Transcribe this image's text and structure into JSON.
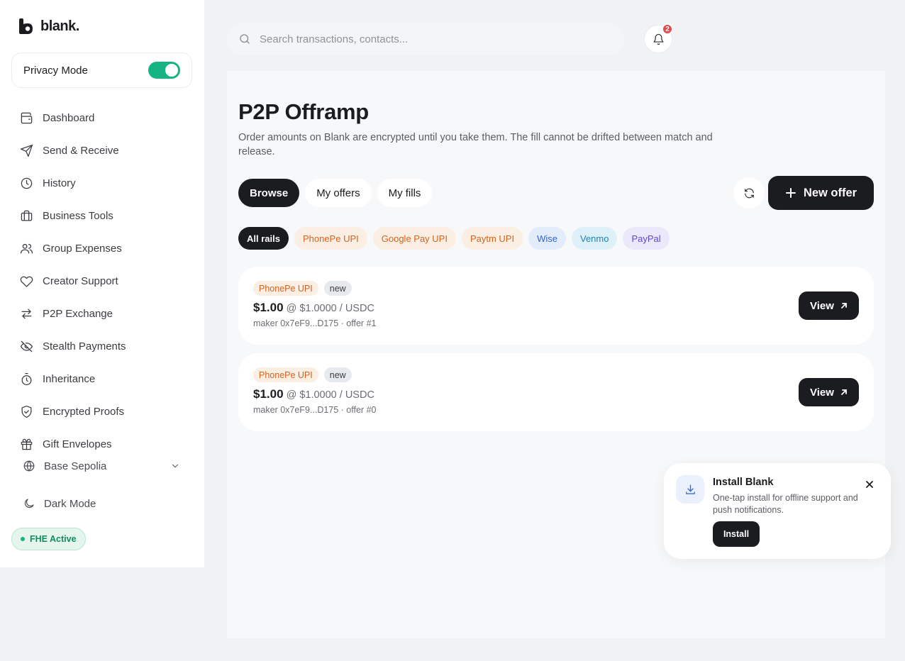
{
  "brand": {
    "name": "blank."
  },
  "privacy": {
    "label": "Privacy Mode",
    "enabled": true
  },
  "sidebar": {
    "items": [
      {
        "label": "Dashboard",
        "icon": "wallet-icon"
      },
      {
        "label": "Send & Receive",
        "icon": "send-icon"
      },
      {
        "label": "History",
        "icon": "clock-icon"
      },
      {
        "label": "Business Tools",
        "icon": "briefcase-icon"
      },
      {
        "label": "Group Expenses",
        "icon": "users-icon"
      },
      {
        "label": "Creator Support",
        "icon": "heart-icon"
      },
      {
        "label": "P2P Exchange",
        "icon": "arrows-exchange-icon"
      },
      {
        "label": "Stealth Payments",
        "icon": "eye-off-icon"
      },
      {
        "label": "Inheritance",
        "icon": "timer-icon"
      },
      {
        "label": "Encrypted Proofs",
        "icon": "shield-check-icon"
      },
      {
        "label": "Gift Envelopes",
        "icon": "gift-icon"
      }
    ],
    "network": "Base Sepolia",
    "dark_mode": "Dark Mode",
    "fhe_status": "FHE Active"
  },
  "header": {
    "search_placeholder": "Search transactions, contacts...",
    "notification_count": "2"
  },
  "main": {
    "title": "P2P Offramp",
    "subtitle": "Order amounts on Blank are encrypted until you take them. The fill cannot be drifted between match and release.",
    "tabs": [
      {
        "label": "Browse",
        "active": true
      },
      {
        "label": "My offers",
        "active": false
      },
      {
        "label": "My fills",
        "active": false
      }
    ],
    "new_offer_label": "New offer",
    "rails": [
      {
        "label": "All rails",
        "active": true
      },
      {
        "label": "PhonePe UPI",
        "color": "#d8621d"
      },
      {
        "label": "Google Pay UPI",
        "color": "#d8621d"
      },
      {
        "label": "Paytm UPI",
        "color": "#d8621d"
      },
      {
        "label": "Wise",
        "color": "#2e64d6"
      },
      {
        "label": "Venmo",
        "color": "#1a83b8"
      },
      {
        "label": "PayPal",
        "color": "#5b49cf"
      }
    ],
    "offers": [
      {
        "rail": "PhonePe UPI",
        "status": "new",
        "amount": "$1.00",
        "rate": "@ $1.0000 / USDC",
        "meta": "maker 0x7eF9...D175 · offer #1",
        "action": "View"
      },
      {
        "rail": "PhonePe UPI",
        "status": "new",
        "amount": "$1.00",
        "rate": "@ $1.0000 / USDC",
        "meta": "maker 0x7eF9...D175 · offer #0",
        "action": "View"
      }
    ]
  },
  "toast": {
    "title": "Install Blank",
    "body": "One-tap install for offline support and push notifications.",
    "button": "Install"
  },
  "colors": {
    "accent": "#16b483",
    "primary": "#1b1c1f",
    "badge": "#e5484d"
  }
}
